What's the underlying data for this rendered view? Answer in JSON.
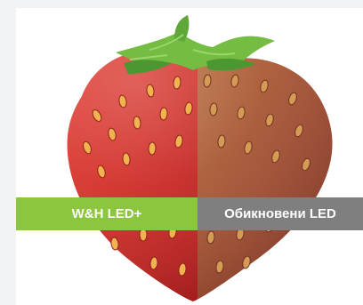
{
  "labels": {
    "left": "W&H LED+",
    "right": "Обикновени LED"
  },
  "colors": {
    "page_background": "#f2f3f5",
    "photo_background": "#ffffff",
    "left_label_bg": "#8cc63e",
    "right_label_bg": "#7f7f7f",
    "strawberry_bright": "#d7332e",
    "strawberry_dull": "#a85b37",
    "leaves": "#72bb42"
  },
  "icons": {
    "image": "strawberry-comparison-image"
  }
}
